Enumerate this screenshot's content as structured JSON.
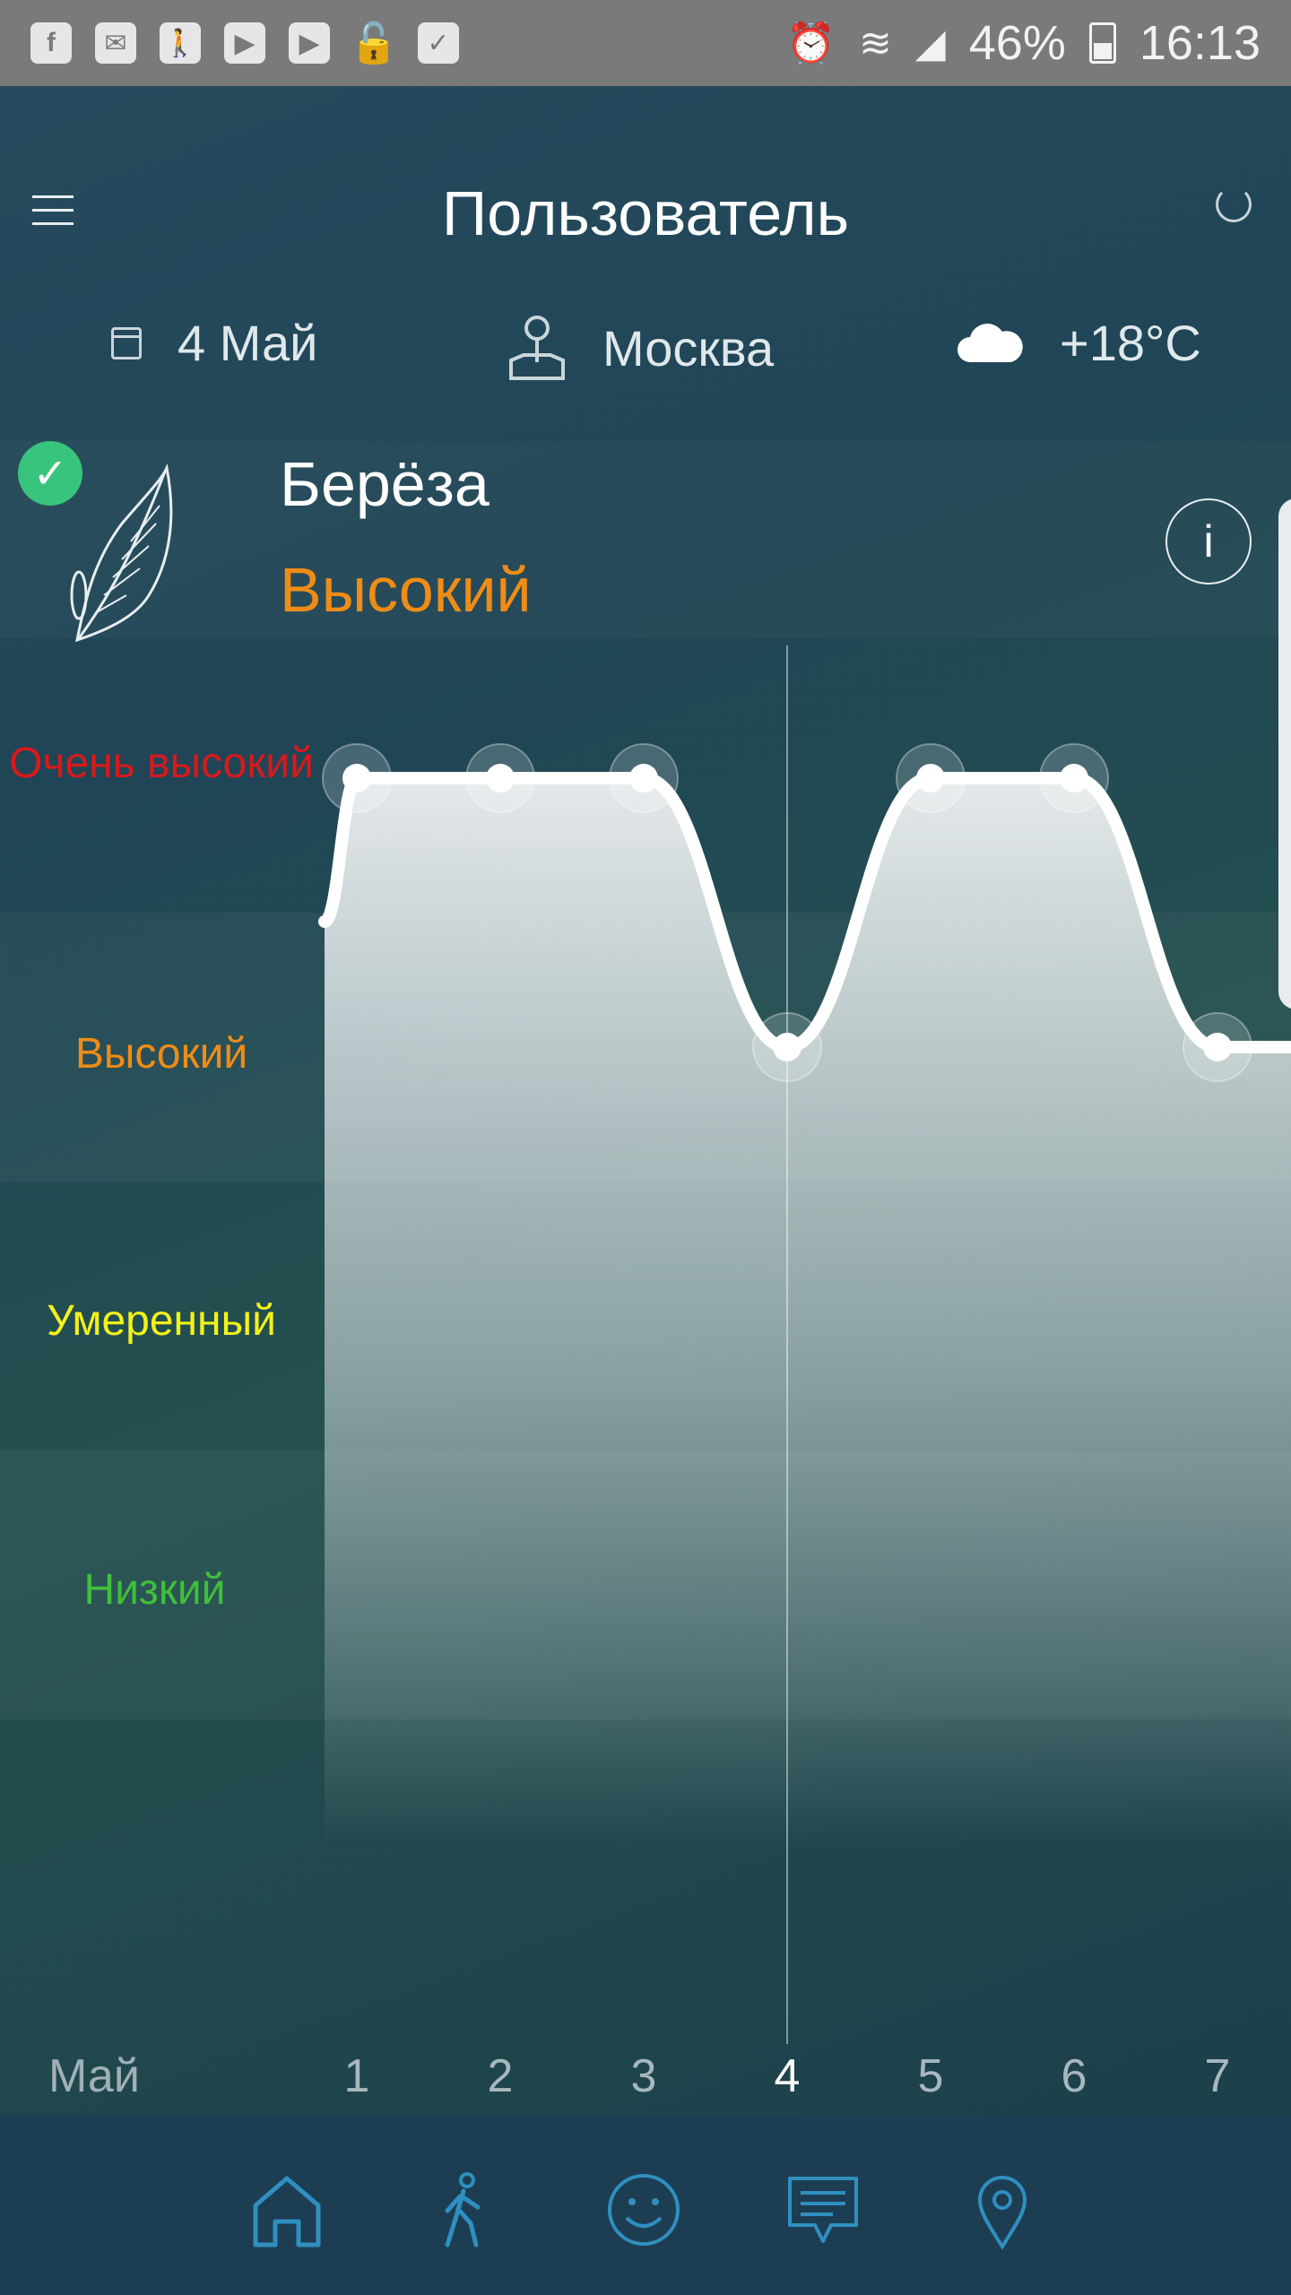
{
  "status_bar": {
    "battery": "46%",
    "time": "16:13",
    "icons": [
      "facebook-icon",
      "mail-icon",
      "walker-icon",
      "youtube-icon",
      "youtube-icon",
      "vpn-lock-icon",
      "briefcase-check-icon",
      "alarm-icon",
      "wifi-icon",
      "signal-icon",
      "battery-icon"
    ]
  },
  "header": {
    "title": "Пользователь"
  },
  "info": {
    "date": "4 Май",
    "city": "Москва",
    "temperature": "+18°C"
  },
  "plant": {
    "name": "Берёза",
    "level": "Высокий",
    "level_color": "#f08c16",
    "info_label": "i"
  },
  "chart_data": {
    "type": "area",
    "x_label_month": "Май",
    "categories": [
      "1",
      "2",
      "3",
      "4",
      "5",
      "6",
      "7"
    ],
    "levels": [
      "Очень высокий",
      "Высокий",
      "Умеренный",
      "Низкий"
    ],
    "level_colors": [
      "#d8191c",
      "#f08c16",
      "#f2f21a",
      "#3fbf3a"
    ],
    "values": [
      4,
      4,
      4,
      3,
      4,
      4,
      3
    ],
    "current_index": 3,
    "y_range": [
      0,
      4
    ]
  },
  "nav": {
    "items": [
      "home-icon",
      "walk-icon",
      "smiley-icon",
      "message-icon",
      "location-icon"
    ]
  }
}
